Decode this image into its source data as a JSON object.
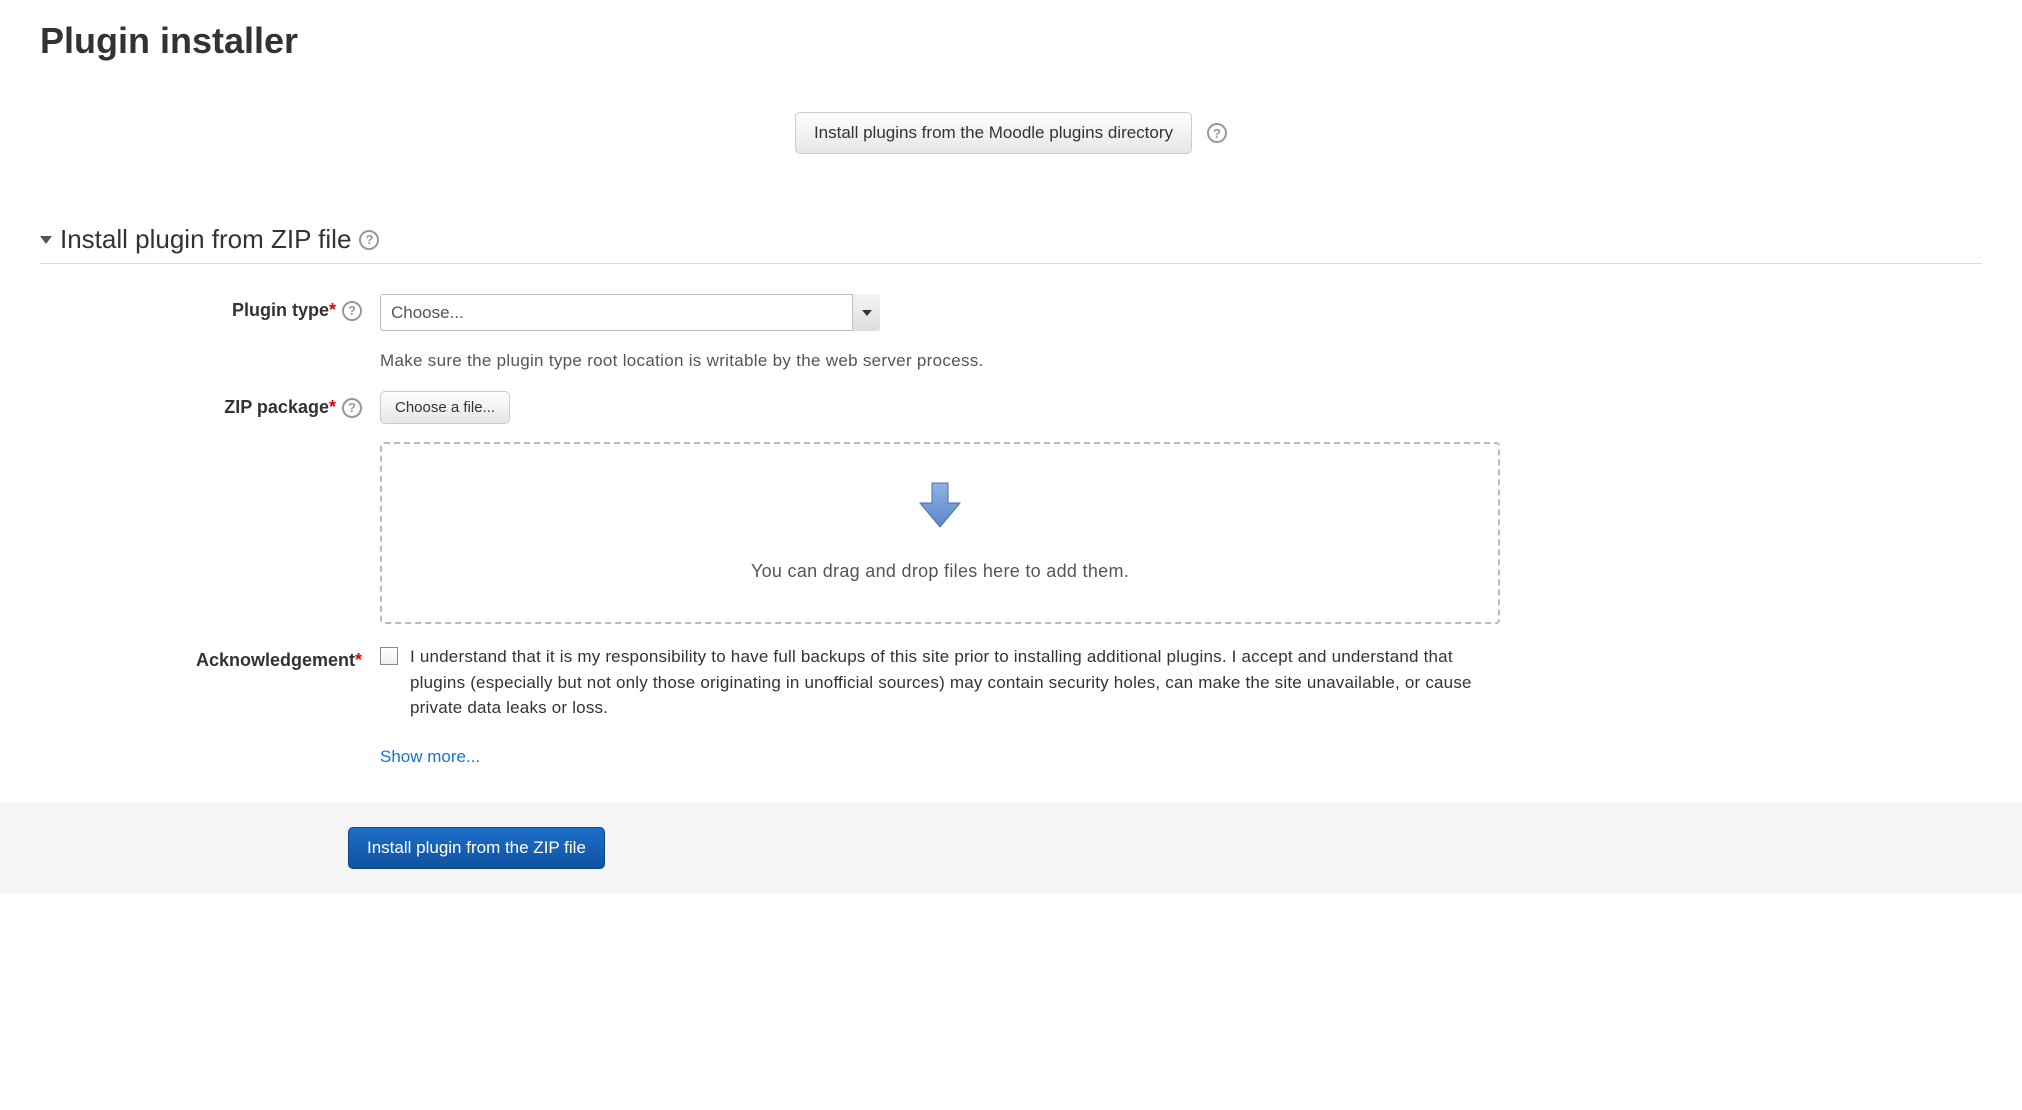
{
  "page": {
    "title": "Plugin installer"
  },
  "top": {
    "install_from_directory_label": "Install plugins from the Moodle plugins directory"
  },
  "section": {
    "title": "Install plugin from ZIP file"
  },
  "form": {
    "plugin_type": {
      "label": "Plugin type",
      "selected": "Choose...",
      "hint": "Make sure the plugin type root location is writable by the web server process."
    },
    "zip_package": {
      "label": "ZIP package",
      "choose_file_label": "Choose a file...",
      "dropzone_text": "You can drag and drop files here to add them."
    },
    "acknowledgement": {
      "label": "Acknowledgement",
      "text": "I understand that it is my responsibility to have full backups of this site prior to installing additional plugins. I accept and understand that plugins (especially but not only those originating in unofficial sources) may contain security holes, can make the site unavailable, or cause private data leaks or loss.",
      "show_more": "Show more..."
    },
    "submit_label": "Install plugin from the ZIP file"
  }
}
